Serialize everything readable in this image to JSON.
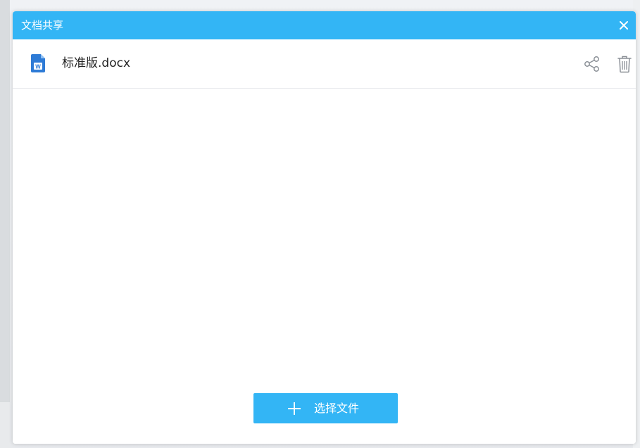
{
  "dialog": {
    "title": "文档共享",
    "close_icon": "close-icon"
  },
  "files": [
    {
      "name": "标准版.docx",
      "type_icon": "word-document-icon",
      "type_badge": "W",
      "actions": [
        "share-icon",
        "trash-icon"
      ]
    }
  ],
  "footer": {
    "select_button_label": "选择文件",
    "select_button_icon": "plus-icon"
  },
  "colors": {
    "accent": "#33b5f5",
    "word_icon": "#2e7bd6",
    "action_icon": "#8a8f96"
  }
}
